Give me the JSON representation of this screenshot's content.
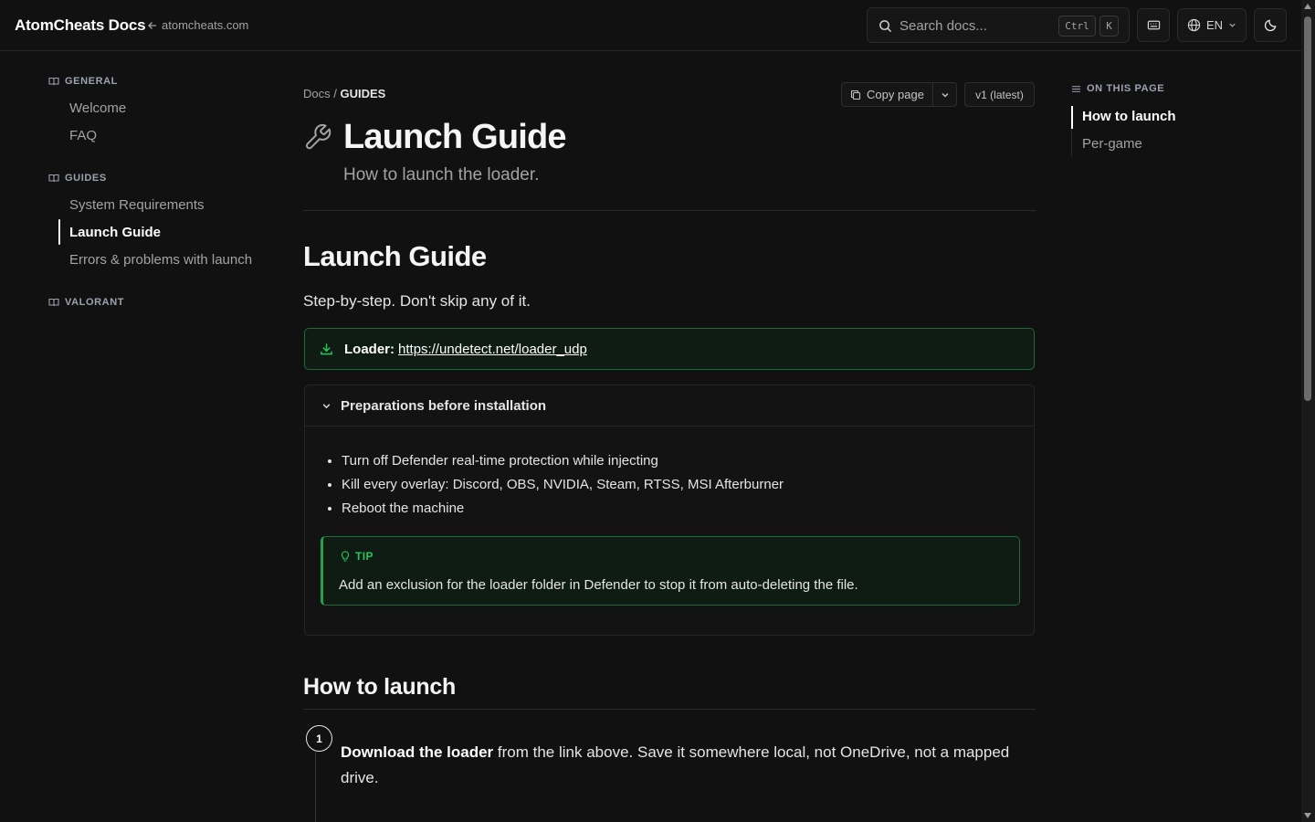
{
  "header": {
    "brand": "AtomCheats Docs",
    "back_link": "atomcheats.com",
    "search_placeholder": "Search docs...",
    "kbd_ctrl": "Ctrl",
    "kbd_k": "K",
    "language": "EN"
  },
  "sidebar": {
    "groups": [
      {
        "title": "GENERAL",
        "items": [
          {
            "label": "Welcome"
          },
          {
            "label": "FAQ"
          }
        ]
      },
      {
        "title": "GUIDES",
        "items": [
          {
            "label": "System Requirements"
          },
          {
            "label": "Launch Guide",
            "active": true
          },
          {
            "label": "Errors & problems with launch"
          }
        ]
      },
      {
        "title": "VALORANT",
        "items": []
      }
    ]
  },
  "page": {
    "breadcrumb_root": "Docs",
    "breadcrumb_sep": "/",
    "breadcrumb_current": "GUIDES",
    "copy_page_label": "Copy page",
    "version_label": "v1 (latest)",
    "title": "Launch Guide",
    "subtitle": "How to launch the loader.",
    "section_heading": "Launch Guide",
    "lead": "Step-by-step. Don't skip any of it.",
    "loader_label": "Loader:",
    "loader_url": "https://undetect.net/loader_udp",
    "collapse_title": "Preparations before installation",
    "prep_items": [
      "Turn off Defender real-time protection while injecting",
      "Kill every overlay: Discord, OBS, NVIDIA, Steam, RTSS, MSI Afterburner",
      "Reboot the machine"
    ],
    "tip_label": "TIP",
    "tip_text": "Add an exclusion for the loader folder in Defender to stop it from auto-deleting the file.",
    "how_heading": "How to launch",
    "step_number": "1",
    "step_bold": "Download the loader",
    "step_text": " from the link above. Save it somewhere local, not OneDrive, not a mapped drive."
  },
  "toc": {
    "title": "ON THIS PAGE",
    "items": [
      {
        "label": "How to launch",
        "active": true
      },
      {
        "label": "Per-game"
      }
    ]
  },
  "colors": {
    "background": "#111111",
    "accent_green": "#22c55e",
    "callout_border": "#1f6b3a",
    "text_primary": "#e5e5e5",
    "text_muted": "#a3a3a3"
  },
  "icons": {
    "back": "arrow-left-icon",
    "search": "search-icon",
    "keyboard": "keyboard-icon",
    "language": "globe-icon",
    "theme": "moon-icon",
    "group": "book-icon",
    "copy": "copy-icon",
    "title": "wrench-icon",
    "loader": "download-icon",
    "collapse": "chevron-down-icon",
    "tip": "lightbulb-icon",
    "toc": "list-icon"
  }
}
